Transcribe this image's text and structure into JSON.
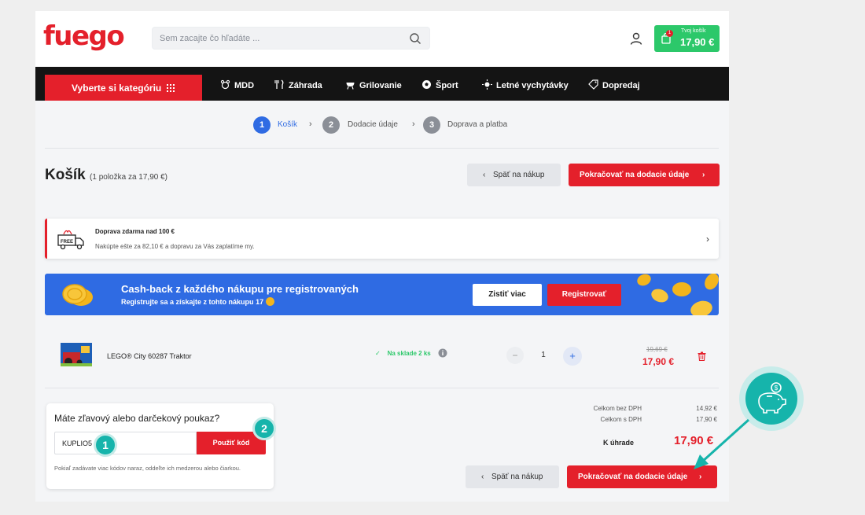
{
  "header": {
    "logo": "fuego",
    "search_placeholder": "Sem zacajte čo hľadáte ...",
    "cart_label": "Tvoj košík",
    "cart_total": "17,90 €",
    "cart_badge": "1"
  },
  "nav": {
    "category_button": "Vyberte si kategóriu",
    "items": [
      "MDD",
      "Záhrada",
      "Grilovanie",
      "Šport",
      "Letné vychytávky",
      "Dopredaj"
    ]
  },
  "steps": [
    {
      "num": "1",
      "label": "Košík"
    },
    {
      "num": "2",
      "label": "Dodacie údaje"
    },
    {
      "num": "3",
      "label": "Doprava a platba"
    }
  ],
  "cart": {
    "title": "Košík",
    "subtitle": "(1 položka za 17,90 €)",
    "back_button": "Späť na nákup",
    "continue_button": "Pokračovať na dodacie údaje"
  },
  "shipping": {
    "title": "Doprava zdarma nad 100 €",
    "text": "Nakúpte ešte za 82,10 € a dopravu za Vás zaplatíme my.",
    "icon_text": "FREE"
  },
  "cashback": {
    "title": "Cash-back z každého nákupu pre registrovaných",
    "subtitle": "Registrujte sa a získajte z tohto nákupu",
    "amount": "17",
    "more_button": "Zistiť viac",
    "register_button": "Registrovať"
  },
  "product": {
    "name": "LEGO® City 60287 Traktor",
    "stock": "Na sklade 2 ks",
    "quantity": "1",
    "old_price": "19,69 €",
    "price": "17,90 €"
  },
  "voucher": {
    "title": "Máte zľavový alebo darčekový poukaz?",
    "input_value": "KUPLIO5",
    "apply_button": "Použiť kód",
    "note": "Pokiaľ zadávate viac kódov naraz, oddeľte ich medzerou alebo čiarkou."
  },
  "summary": {
    "without_vat_label": "Celkom bez DPH",
    "without_vat_value": "14,92 €",
    "with_vat_label": "Celkom s DPH",
    "with_vat_value": "17,90 €",
    "total_label": "K úhrade",
    "total_value": "17,90 €"
  },
  "annotations": [
    "1",
    "2"
  ],
  "colors": {
    "brand_red": "#e4202b",
    "accent_blue": "#2f6be3",
    "cart_green": "#2cc86a",
    "annotation_teal": "#16b4ab"
  }
}
